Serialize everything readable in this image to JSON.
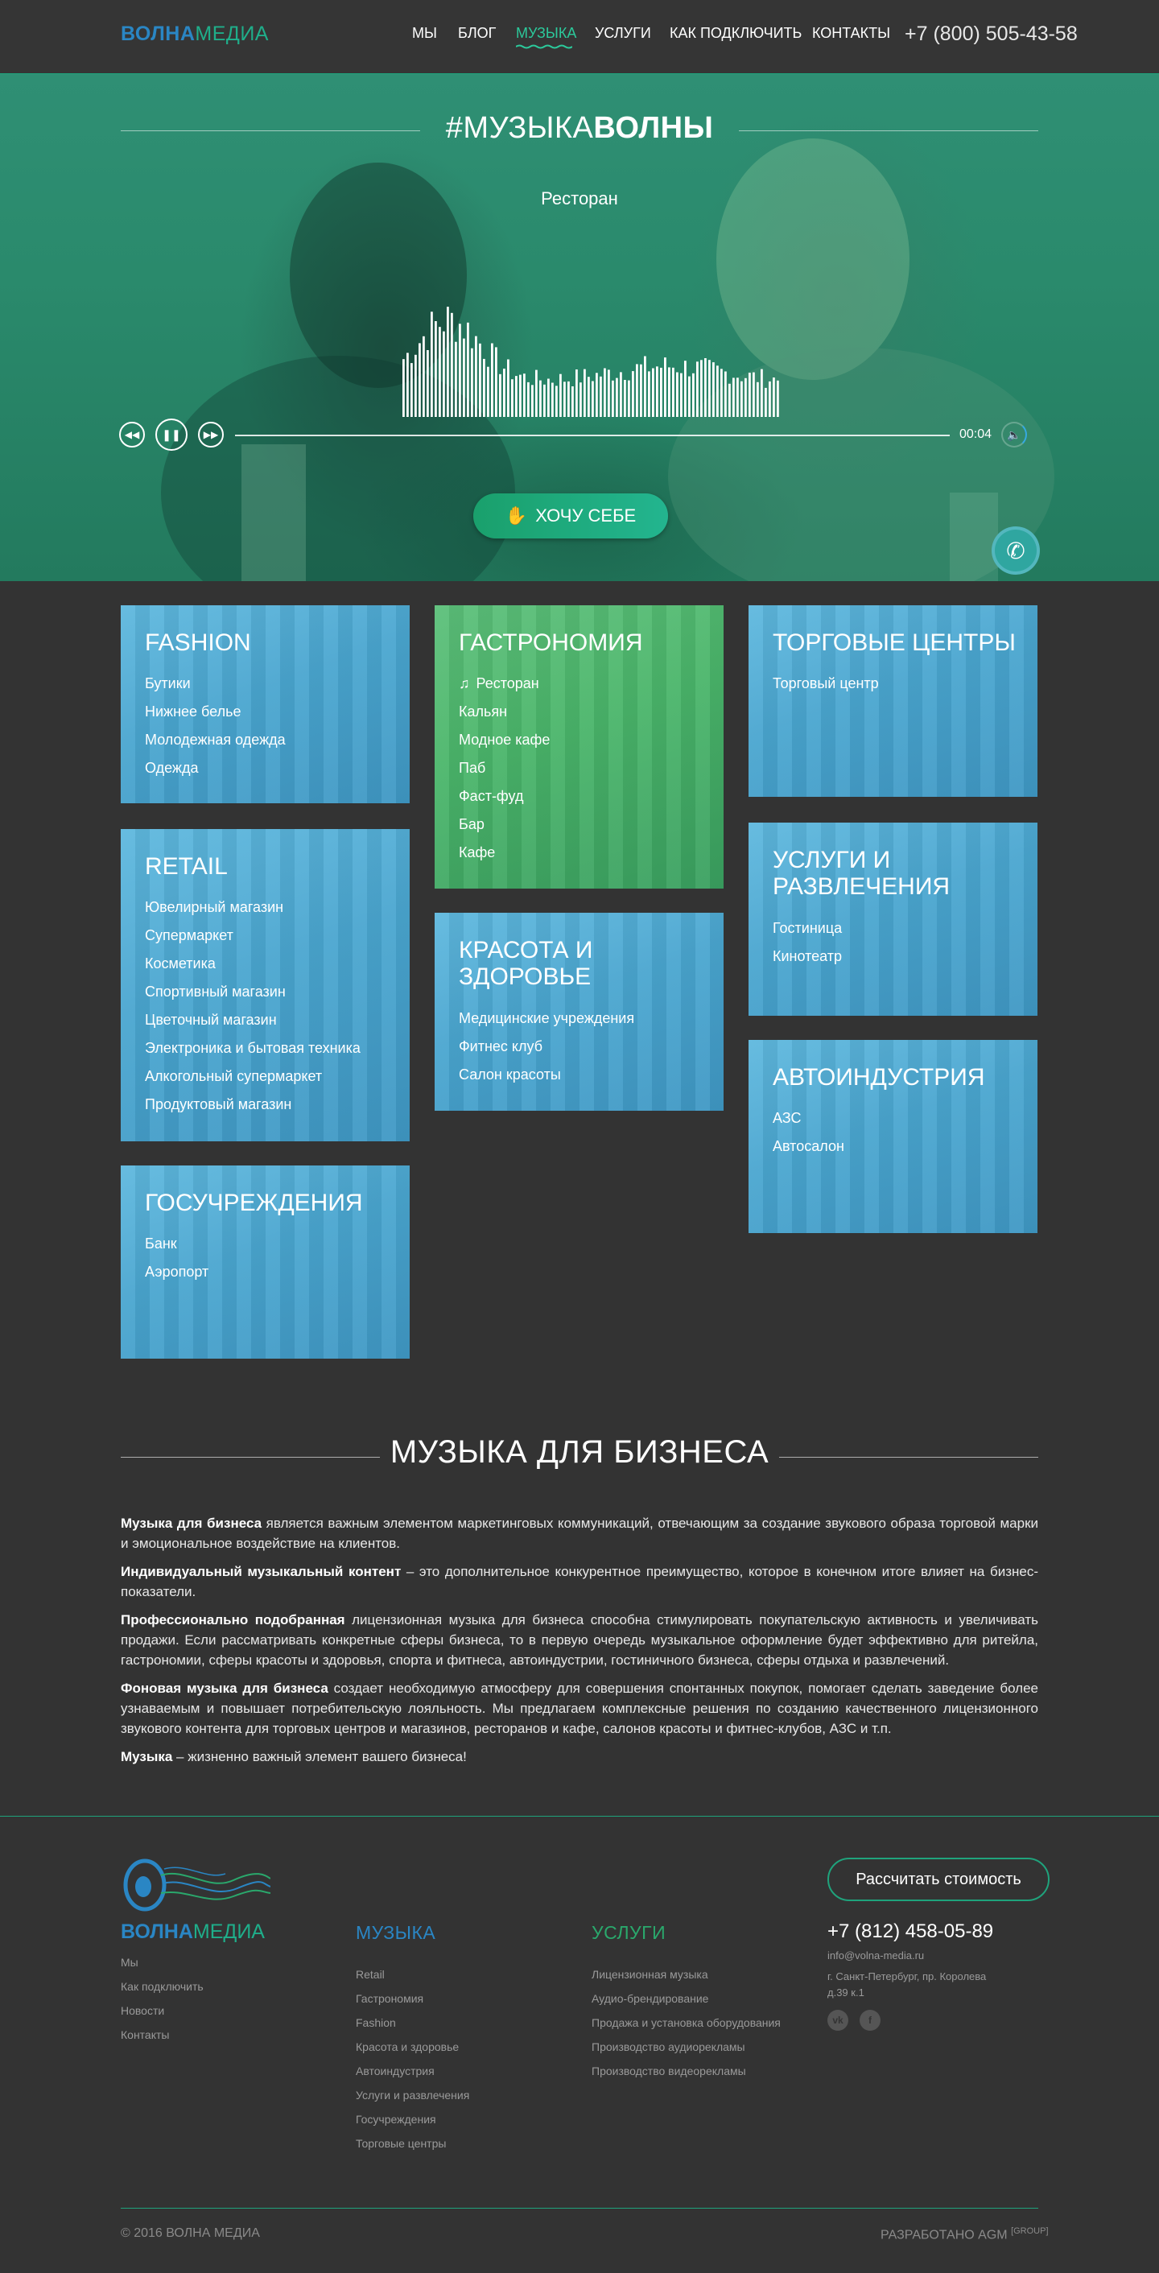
{
  "header": {
    "logo_bold": "ВОЛНА",
    "logo_light": "МЕДИА",
    "nav": [
      {
        "label": "МЫ"
      },
      {
        "label": "БЛОГ"
      },
      {
        "label": "МУЗЫКА"
      },
      {
        "label": "УСЛУГИ"
      },
      {
        "label": "КАК ПОДКЛЮЧИТЬ"
      },
      {
        "label": "КОНТАКТЫ"
      }
    ],
    "active_nav": "МУЗЫКА",
    "phone": "+7 (800) 505-43-58"
  },
  "hero": {
    "title_light": "#МУЗЫКА",
    "title_bold": "ВОЛНЫ",
    "subtitle": "Ресторан",
    "time": "00:04",
    "cta_label": "ХОЧУ СЕБЕ",
    "icons": {
      "prev": "rewind-icon",
      "pause": "pause-icon",
      "next": "fast-forward-icon",
      "volume": "volume-icon",
      "call": "phone-icon",
      "cta": "rock-hand-icon"
    }
  },
  "categories": [
    {
      "title": "FASHION",
      "items": [
        "Бутики",
        "Нижнее белье",
        "Молодежная одежда",
        "Одежда"
      ]
    },
    {
      "title": "RETAIL",
      "items": [
        "Ювелирный магазин",
        "Супермаркет",
        "Косметика",
        "Спортивный магазин",
        "Цветочный магазин",
        "Электроника и бытовая техника",
        "Алкогольный супермаркет",
        "Продуктовый магазин"
      ]
    },
    {
      "title": "ГОСУЧРЕЖДЕНИЯ",
      "items": [
        "Банк",
        "Аэропорт"
      ]
    },
    {
      "title": "ГАСТРОНОМИЯ",
      "items": [
        "Ресторан",
        "Кальян",
        "Модное кафе",
        "Паб",
        "Фаст-фуд",
        "Бар",
        "Кафе"
      ],
      "current": "Ресторан"
    },
    {
      "title_line1": "КРАСОТА И",
      "title_line2": "ЗДОРОВЬЕ",
      "items": [
        "Медицинские учреждения",
        "Фитнес клуб",
        "Салон красоты"
      ]
    },
    {
      "title": "ТОРГОВЫЕ ЦЕНТРЫ",
      "items": [
        "Торговый центр"
      ]
    },
    {
      "title_line1": "УСЛУГИ И",
      "title_line2": "РАЗВЛЕЧЕНИЯ",
      "items": [
        "Гостиница",
        "Кинотеатр"
      ]
    },
    {
      "title": "АВТОИНДУСТРИЯ",
      "items": [
        "АЗС",
        "Автосалон"
      ]
    }
  ],
  "business": {
    "title": "МУЗЫКА ДЛЯ БИЗНЕСА",
    "paragraphs": [
      {
        "bold": "Музыка для бизнеса",
        "text": " является важным элементом маркетинговых коммуникаций, отвечающим за создание звукового образа торговой марки и эмоциональное воздействие на клиентов."
      },
      {
        "bold": "Индивидуальный музыкальный контент",
        "text": " – это дополнительное конкурентное преимущество, которое в конечном итоге влияет на бизнес-показатели."
      },
      {
        "bold": "Профессионально подобранная",
        "text": " лицензионная музыка для бизнеса способна стимулировать покупательскую активность и увеличивать продажи. Если рассматривать конкретные сферы бизнеса, то в первую очередь музыкальное оформление будет эффективно для ритейла, гастрономии, сферы красоты и здоровья, спорта и фитнеса, автоиндустрии, гостиничного бизнеса, сферы отдыха и развлечений."
      },
      {
        "bold": "Фоновая музыка для бизнеса",
        "text": " создает необходимую атмосферу для совершения спонтанных покупок, помогает сделать заведение более узнаваемым и повышает потребительскую лояльность. Мы предлагаем комплексные решения по созданию качественного лицензионного звукового контента для торговых центров и магазинов, ресторанов и кафе, салонов красоты и фитнес-клубов, АЗС и т.п."
      },
      {
        "bold": "Музыка",
        "text": " – жизненно важный элемент вашего бизнеса!"
      }
    ]
  },
  "footer": {
    "logo_bold": "ВОЛНА",
    "logo_light": "МЕДИА",
    "col1_links": [
      "Мы",
      "Как подключить",
      "Новости",
      "Контакты"
    ],
    "col2_title": "МУЗЫКА",
    "col2_links": [
      "Retail",
      "Гастрономия",
      "Fashion",
      "Красота и здоровье",
      "Автоиндустрия",
      "Услуги и развлечения",
      "Госучреждения",
      "Торговые центры"
    ],
    "col3_title": "УСЛУГИ",
    "col3_links": [
      "Лицензионная музыка",
      "Аудио-брендирование",
      "Продажа и установка оборудования",
      "Производство аудиорекламы",
      "Производство видеорекламы"
    ],
    "calc_button": "Рассчитать стоимость",
    "phone": "+7 (812) 458-05-89",
    "email": "info@volna-media.ru",
    "address_line1": "г. Санкт-Петербург, пр. Королева",
    "address_line2": "д.39 к.1",
    "social": [
      {
        "label": "vk",
        "icon": "vk-icon"
      },
      {
        "label": "f",
        "icon": "facebook-icon"
      }
    ],
    "copyright": "© 2016 ВОЛНА МЕДИА",
    "developer": "РАЗРАБОТАНО AGM",
    "developer_sup": "[GROUP]"
  },
  "colors": {
    "background": "#333333",
    "accent_green": "#1fa37c",
    "brand_blue": "#2a86c4",
    "card_blue": "#4aa6d0",
    "card_green": "#4ab56a"
  }
}
